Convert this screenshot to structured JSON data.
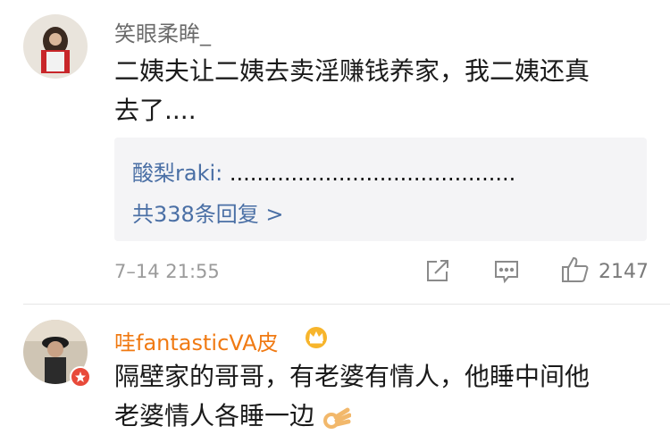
{
  "comments": [
    {
      "username": "笑眼柔眸_",
      "text_line1": "二姨夫让二姨去卖淫赚钱养家，我二姨还真",
      "text_line2": "去了....",
      "reply": {
        "author": "酸梨raki:",
        "text": " ..........................................",
        "more": "共338条回复 >"
      },
      "time": "7–14 21:55",
      "likes": "2147"
    },
    {
      "username": "哇fantasticVA皮",
      "text_line1": "隔壁家的哥哥，有老婆有情人，他睡中间他",
      "text_line2": "老婆情人各睡一边"
    }
  ],
  "colors": {
    "link": "#4a6fa5",
    "vip_name": "#f07a13",
    "reply_bg": "#f4f4f6"
  },
  "icons": [
    "share-icon",
    "comment-icon",
    "like-icon",
    "crown-icon",
    "ok-hand-emoji",
    "verified-badge-icon"
  ]
}
